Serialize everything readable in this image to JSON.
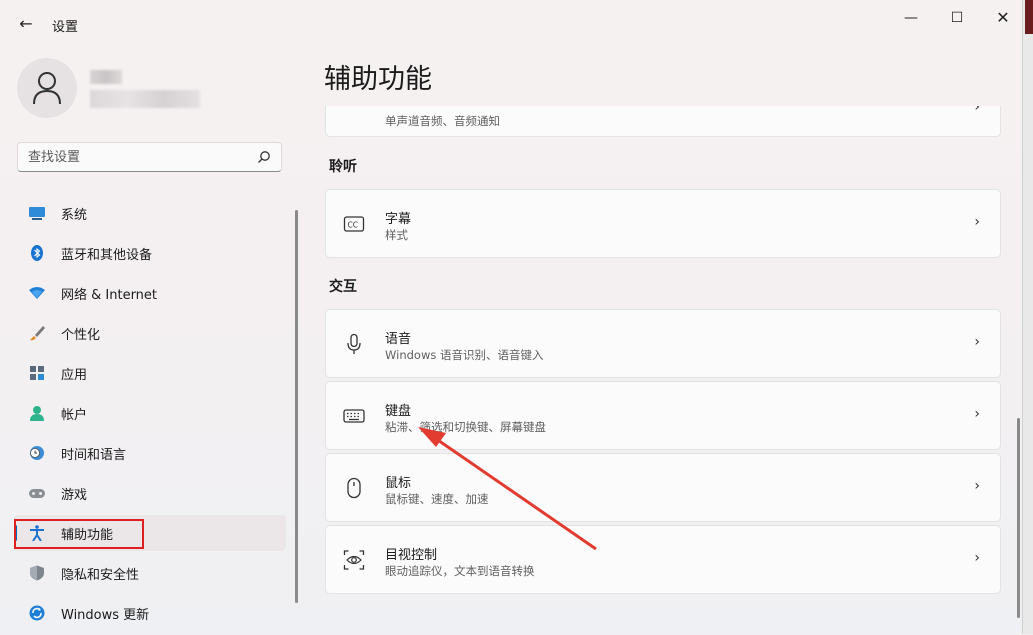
{
  "window": {
    "back_glyph": "←",
    "app_title": "设置",
    "min_glyph": "—",
    "max_glyph": "☐",
    "close_glyph": "✕"
  },
  "search": {
    "placeholder": "查找设置"
  },
  "nav": {
    "items": [
      {
        "label": "系统",
        "icon": "system-icon"
      },
      {
        "label": "蓝牙和其他设备",
        "icon": "bluetooth-icon"
      },
      {
        "label": "网络 & Internet",
        "icon": "wifi-icon"
      },
      {
        "label": "个性化",
        "icon": "brush-icon"
      },
      {
        "label": "应用",
        "icon": "apps-icon"
      },
      {
        "label": "帐户",
        "icon": "account-icon"
      },
      {
        "label": "时间和语言",
        "icon": "clock-globe-icon"
      },
      {
        "label": "游戏",
        "icon": "gamepad-icon"
      },
      {
        "label": "辅助功能",
        "icon": "accessibility-icon",
        "selected": true
      },
      {
        "label": "隐私和安全性",
        "icon": "shield-icon"
      },
      {
        "label": "Windows 更新",
        "icon": "update-icon"
      }
    ]
  },
  "main": {
    "page_title": "辅助功能",
    "partial_card": {
      "subtitle": "单声道音频、音频通知"
    },
    "sections": [
      {
        "label": "聆听",
        "cards": [
          {
            "title": "字幕",
            "subtitle": "样式",
            "icon": "captions-icon"
          }
        ]
      },
      {
        "label": "交互",
        "cards": [
          {
            "title": "语音",
            "subtitle": "Windows 语音识别、语音键入",
            "icon": "microphone-icon"
          },
          {
            "title": "键盘",
            "subtitle": "粘滞、筛选和切换键、屏幕键盘",
            "icon": "keyboard-icon"
          },
          {
            "title": "鼠标",
            "subtitle": "鼠标键、速度、加速",
            "icon": "mouse-icon"
          },
          {
            "title": "目视控制",
            "subtitle": "眼动追踪仪，文本到语音转换",
            "icon": "eye-control-icon"
          }
        ]
      }
    ],
    "chevron": "›"
  },
  "colors": {
    "accent": "#0067c0",
    "annotation_red": "#e02020"
  }
}
